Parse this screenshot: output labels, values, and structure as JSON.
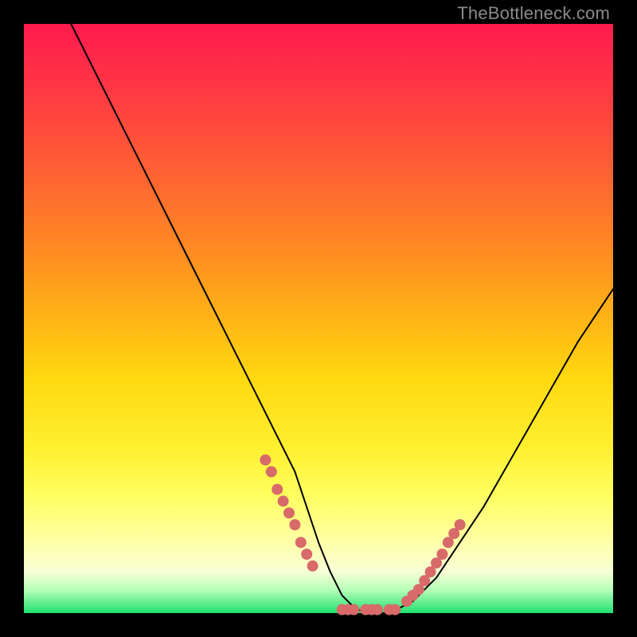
{
  "watermark": "TheBottleneck.com",
  "colors": {
    "background": "#000000",
    "curve": "#000000",
    "dot": "#d86a6a",
    "gradient_top": "#ff1a4d",
    "gradient_bottom": "#20e070"
  },
  "chart_data": {
    "type": "line",
    "title": "",
    "xlabel": "",
    "ylabel": "",
    "xlim": [
      0,
      100
    ],
    "ylim": [
      0,
      100
    ],
    "grid": false,
    "legend": false,
    "series": [
      {
        "name": "bottleneck-curve",
        "x": [
          8,
          12,
          16,
          20,
          24,
          28,
          32,
          36,
          40,
          44,
          46,
          48,
          50,
          52,
          54,
          56,
          58,
          60,
          62,
          66,
          70,
          74,
          78,
          82,
          86,
          90,
          94,
          98,
          100
        ],
        "y": [
          100,
          92,
          84,
          76,
          68,
          60,
          52,
          44,
          36,
          28,
          24,
          18,
          12,
          7,
          3,
          1,
          0,
          0,
          0,
          2,
          6,
          12,
          18,
          25,
          32,
          39,
          46,
          52,
          55
        ]
      }
    ],
    "annotations": {
      "left_cluster": {
        "x_range": [
          40,
          50
        ],
        "y_range": [
          6,
          24
        ]
      },
      "right_cluster": {
        "x_range": [
          64,
          74
        ],
        "y_range": [
          2,
          16
        ]
      },
      "floor_cluster": {
        "x_range": [
          52,
          64
        ],
        "y_range": [
          0,
          1
        ]
      }
    },
    "dots_left": [
      {
        "x": 41,
        "y": 26
      },
      {
        "x": 42,
        "y": 24
      },
      {
        "x": 43,
        "y": 21
      },
      {
        "x": 44,
        "y": 19
      },
      {
        "x": 45,
        "y": 17
      },
      {
        "x": 46,
        "y": 15
      },
      {
        "x": 47,
        "y": 12
      },
      {
        "x": 48,
        "y": 10
      },
      {
        "x": 49,
        "y": 8
      }
    ],
    "dots_floor": [
      {
        "x": 54,
        "y": 0.6
      },
      {
        "x": 55,
        "y": 0.6
      },
      {
        "x": 56,
        "y": 0.6
      },
      {
        "x": 58,
        "y": 0.6
      },
      {
        "x": 59,
        "y": 0.6
      },
      {
        "x": 60,
        "y": 0.6
      },
      {
        "x": 62,
        "y": 0.6
      },
      {
        "x": 63,
        "y": 0.6
      }
    ],
    "dots_right": [
      {
        "x": 65,
        "y": 2
      },
      {
        "x": 66,
        "y": 3
      },
      {
        "x": 67,
        "y": 4
      },
      {
        "x": 68,
        "y": 5.5
      },
      {
        "x": 69,
        "y": 7
      },
      {
        "x": 70,
        "y": 8.5
      },
      {
        "x": 71,
        "y": 10
      },
      {
        "x": 72,
        "y": 12
      },
      {
        "x": 73,
        "y": 13.5
      },
      {
        "x": 74,
        "y": 15
      }
    ]
  }
}
